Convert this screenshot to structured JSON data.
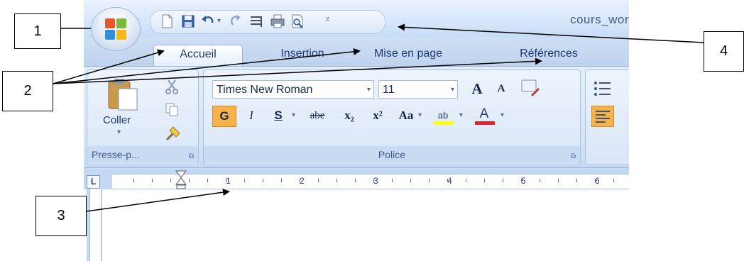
{
  "window": {
    "doc_title": "cours_wor"
  },
  "tabs": [
    {
      "label": "Accueil"
    },
    {
      "label": "Insertion"
    },
    {
      "label": "Mise en page"
    },
    {
      "label": "Références"
    }
  ],
  "clipboard": {
    "paste_label": "Coller",
    "group_label": "Presse-p..."
  },
  "font": {
    "group_label": "Police",
    "font_name": "Times New Roman",
    "font_size": "11",
    "bold": "G",
    "italic": "I",
    "underline": "S",
    "strike": "abe",
    "subscript": "x₂",
    "superscript": "x²",
    "change_case": "Aa",
    "grow": "A",
    "shrink": "A",
    "highlight": "ab",
    "font_color": "A"
  },
  "ruler": {
    "corner": "L",
    "numbers": [
      "1",
      "2",
      "3",
      "4",
      "5",
      "6"
    ]
  },
  "callouts": {
    "c1": "1",
    "c2": "2",
    "c3": "3",
    "c4": "4"
  },
  "icons": [
    "office-button-icon",
    "new-doc-icon",
    "save-icon",
    "undo-icon",
    "redo-icon",
    "paragraph-mark-icon",
    "print-icon",
    "print-preview-icon",
    "qat-dropdown-icon",
    "paste-icon",
    "cut-icon",
    "copy-icon",
    "format-painter-icon",
    "bullets-icon",
    "align-left-icon"
  ],
  "colors": {
    "ribbon": "#d6e4f7",
    "titlebar": "#d7e6fa",
    "highlight": "#ffff00",
    "font_color": "#e0262c",
    "bold_active": "#f7b24a"
  }
}
